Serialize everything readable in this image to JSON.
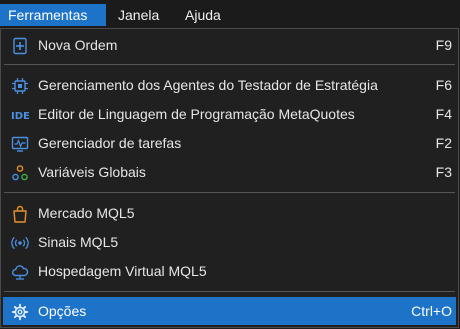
{
  "menubar": {
    "items": [
      {
        "label": "Ferramentas"
      },
      {
        "label": "Janela"
      },
      {
        "label": "Ajuda"
      }
    ]
  },
  "menu": {
    "items": [
      {
        "label": "Nova Ordem",
        "shortcut": "F9",
        "icon": "new-order-icon"
      },
      {
        "label": "Gerenciamento dos Agentes do Testador de Estratégia",
        "shortcut": "F6",
        "icon": "chip-icon"
      },
      {
        "label": "Editor de Linguagem de Programação MetaQuotes",
        "shortcut": "F4",
        "icon": "ide-icon"
      },
      {
        "label": "Gerenciador de tarefas",
        "shortcut": "F2",
        "icon": "monitor-icon"
      },
      {
        "label": "Variáveis Globais",
        "shortcut": "F3",
        "icon": "variables-icon"
      },
      {
        "label": "Mercado MQL5",
        "shortcut": "",
        "icon": "shopping-bag-icon"
      },
      {
        "label": "Sinais MQL5",
        "shortcut": "",
        "icon": "signal-icon"
      },
      {
        "label": "Hospedagem Virtual MQL5",
        "shortcut": "",
        "icon": "cloud-icon"
      },
      {
        "label": "Opções",
        "shortcut": "Ctrl+O",
        "icon": "gear-icon"
      }
    ],
    "ide_icon_text": "IDE"
  },
  "colors": {
    "accent": "#1c73c8",
    "background": "#202020",
    "icon_blue": "#4a90e2",
    "icon_orange": "#e8902a",
    "icon_green": "#3cb043"
  }
}
